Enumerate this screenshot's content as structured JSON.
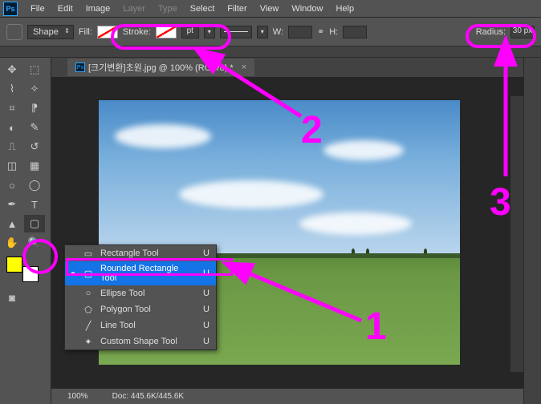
{
  "menu": {
    "items": [
      "File",
      "Edit",
      "Image",
      "Layer",
      "Type",
      "Select",
      "Filter",
      "View",
      "Window",
      "Help"
    ],
    "disabled": [
      "Layer",
      "Type"
    ]
  },
  "options_bar": {
    "shape_label": "Shape",
    "fill_label": "Fill:",
    "stroke_label": "Stroke:",
    "stroke_pt": "pt",
    "w_label": "W:",
    "h_label": "H:",
    "radius_label": "Radius:",
    "radius_value": "30 px"
  },
  "doc_tab": {
    "title": "[크기변환]초원.jpg @ 100% (RGB/8) *"
  },
  "tool_flyout": {
    "items": [
      {
        "label": "Rectangle Tool",
        "key": "U",
        "icon": "▭",
        "selected": false
      },
      {
        "label": "Rounded Rectangle Tool",
        "key": "U",
        "icon": "▢",
        "selected": true
      },
      {
        "label": "Ellipse Tool",
        "key": "U",
        "icon": "○",
        "selected": false
      },
      {
        "label": "Polygon Tool",
        "key": "U",
        "icon": "⬠",
        "selected": false
      },
      {
        "label": "Line Tool",
        "key": "U",
        "icon": "╱",
        "selected": false
      },
      {
        "label": "Custom Shape Tool",
        "key": "U",
        "icon": "✦",
        "selected": false
      }
    ]
  },
  "status": {
    "zoom": "100%",
    "doc_info": "Doc: 445.6K/445.6K"
  },
  "annotations": {
    "n1": "1",
    "n2": "2",
    "n3": "3"
  },
  "colors": {
    "fg": "#ffff00",
    "bg": "#ffffff"
  }
}
